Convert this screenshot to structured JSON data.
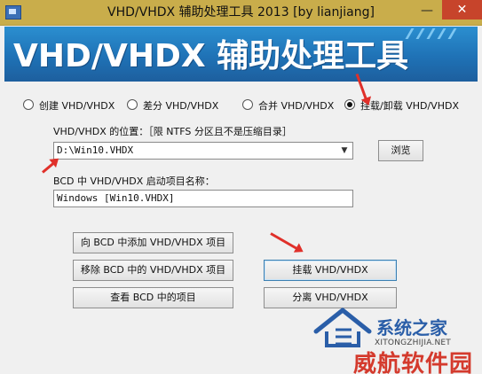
{
  "window": {
    "title": "VHD/VHDX 辅助处理工具 2013 [by lianjiang]",
    "minimize_glyph": "—",
    "close_glyph": "✕"
  },
  "banner": {
    "title": "VHD/VHDX 辅助处理工具"
  },
  "modes": [
    {
      "label": "创建 VHD/VHDX",
      "checked": false
    },
    {
      "label": "差分 VHD/VHDX",
      "checked": false
    },
    {
      "label": "合并 VHD/VHDX",
      "checked": false
    },
    {
      "label": "挂载/卸载 VHD/VHDX",
      "checked": true
    }
  ],
  "location": {
    "label": "VHD/VHDX 的位置：［限 NTFS 分区且不是压缩目录］",
    "value": "D:\\Win10.VHDX",
    "browse_label": "浏览"
  },
  "bcd_name": {
    "label": "BCD 中 VHD/VHDX 启动项目名称：",
    "value": "Windows [Win10.VHDX]"
  },
  "buttons": {
    "add_bcd": "向 BCD 中添加 VHD/VHDX 项目",
    "remove_bcd": "移除 BCD 中的 VHD/VHDX 项目",
    "view_bcd": "查看 BCD 中的项目",
    "mount": "挂载 VHD/VHDX",
    "detach": "分离 VHD/VHDX"
  },
  "watermark": {
    "site_name": "系统之家",
    "url": "XITONGZHIJIA.NET",
    "brand": "威航软件园"
  },
  "colors": {
    "titlebar": "#c9ad4b",
    "banner": "#1f72b6",
    "close": "#c7442b",
    "annotation_arrow": "#e0302a"
  }
}
